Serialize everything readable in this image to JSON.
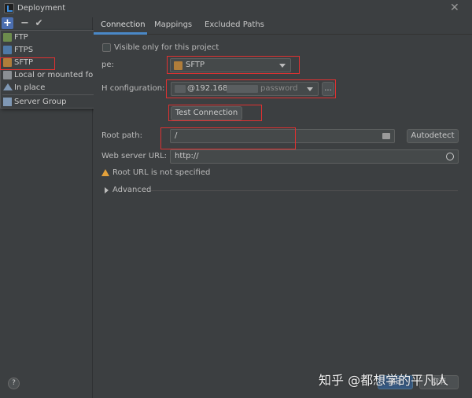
{
  "window": {
    "title": "Deployment",
    "close_icon": "close-icon"
  },
  "toolbar": {
    "add": "+",
    "remove": "−",
    "apply": "✔"
  },
  "server_type_menu": {
    "items": [
      {
        "label": "FTP",
        "icon": "ftp-icon"
      },
      {
        "label": "FTPS",
        "icon": "ftps-icon"
      },
      {
        "label": "SFTP",
        "icon": "sftp-icon"
      },
      {
        "label": "Local or mounted folder",
        "icon": "folder-icon"
      },
      {
        "label": "In place",
        "icon": "home-icon"
      },
      {
        "label": "Server Group",
        "icon": "server-group-icon"
      }
    ]
  },
  "tabs": [
    {
      "label": "Connection"
    },
    {
      "label": "Mappings"
    },
    {
      "label": "Excluded Paths"
    }
  ],
  "connection": {
    "visible_only_label": "Visible only for this project",
    "type_label": "pe:",
    "type_value": "SFTP",
    "ssh_label": "H configuration:",
    "ssh_host": "@192.168",
    "ssh_auth": "password",
    "ssh_more": "...",
    "test_button": "Test Connection",
    "root_path_label": "Root path:",
    "root_path_value": "/",
    "autodetect_button": "Autodetect",
    "web_url_label": "Web server URL:",
    "web_url_value": "http://",
    "warning_text": "Root URL is not specified",
    "advanced_label": "Advanced"
  },
  "footer": {
    "help": "?",
    "ok": "确定",
    "cancel": "取消"
  },
  "watermark": "知乎 @都想学的平凡人",
  "colors": {
    "accent": "#4a88c7",
    "highlight_box": "#e03131",
    "warning": "#e3a13b"
  }
}
